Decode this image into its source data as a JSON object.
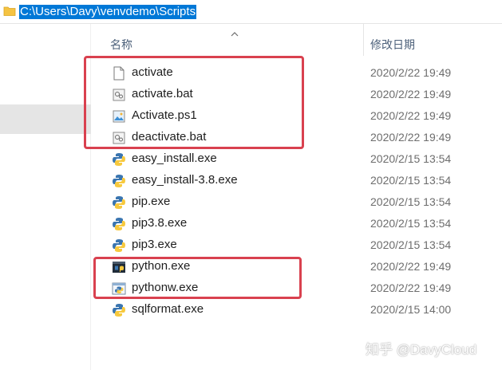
{
  "address_bar": {
    "path": "C:\\Users\\Davy\\venvdemo\\Scripts",
    "icon": "folder-icon"
  },
  "columns": {
    "name": "名称",
    "date_modified": "修改日期",
    "sort_indicator": "chevron-up-icon"
  },
  "files": [
    {
      "name": "activate",
      "date": "2020/2/22 19:49",
      "icon": "blank-file-icon"
    },
    {
      "name": "activate.bat",
      "date": "2020/2/22 19:49",
      "icon": "batch-file-icon"
    },
    {
      "name": "Activate.ps1",
      "date": "2020/2/22 19:49",
      "icon": "image-file-icon"
    },
    {
      "name": "deactivate.bat",
      "date": "2020/2/22 19:49",
      "icon": "batch-file-icon"
    },
    {
      "name": "easy_install.exe",
      "date": "2020/2/15 13:54",
      "icon": "python-exe-icon"
    },
    {
      "name": "easy_install-3.8.exe",
      "date": "2020/2/15 13:54",
      "icon": "python-exe-icon"
    },
    {
      "name": "pip.exe",
      "date": "2020/2/15 13:54",
      "icon": "python-exe-icon"
    },
    {
      "name": "pip3.8.exe",
      "date": "2020/2/15 13:54",
      "icon": "python-exe-icon"
    },
    {
      "name": "pip3.exe",
      "date": "2020/2/15 13:54",
      "icon": "python-exe-icon"
    },
    {
      "name": "python.exe",
      "date": "2020/2/22 19:49",
      "icon": "python-console-icon"
    },
    {
      "name": "pythonw.exe",
      "date": "2020/2/22 19:49",
      "icon": "python-window-icon"
    },
    {
      "name": "sqlformat.exe",
      "date": "2020/2/15 14:00",
      "icon": "python-exe-icon"
    }
  ],
  "watermark": "知乎 @DavyCloud",
  "colors": {
    "selection": "#0078d7",
    "highlight_box": "#d9414f",
    "header_text": "#4c607a",
    "date_text": "#6d6d6d"
  }
}
